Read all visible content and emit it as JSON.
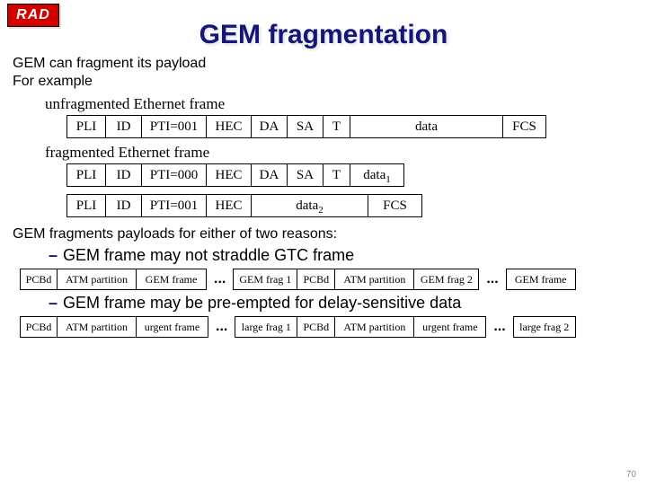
{
  "logo": "RAD",
  "title": "GEM fragmentation",
  "intro": {
    "line1": "GEM can fragment its payload",
    "line2": "For example"
  },
  "subhead_unfrag": "unfragmented Ethernet frame",
  "subhead_frag": "fragmented Ethernet frame",
  "frame_unfrag": {
    "pli": "PLI",
    "id": "ID",
    "pti": "PTI=001",
    "hec": "HEC",
    "da": "DA",
    "sa": "SA",
    "t": "T",
    "data": "data",
    "fcs": "FCS"
  },
  "frame_frag1": {
    "pli": "PLI",
    "id": "ID",
    "pti": "PTI=000",
    "hec": "HEC",
    "da": "DA",
    "sa": "SA",
    "t": "T",
    "data_base": "data",
    "data_sub": "1"
  },
  "frame_frag2": {
    "pli": "PLI",
    "id": "ID",
    "pti": "PTI=001",
    "hec": "HEC",
    "data_base": "data",
    "data_sub": "2",
    "fcs": "FCS"
  },
  "reasons_intro": "GEM fragments payloads for either of two reasons:",
  "bullet1": "GEM frame may not straddle GTC frame",
  "bullet2": "GEM frame may be pre-empted for delay-sensitive data",
  "gtc_row1": {
    "pcbd": "PCBd",
    "atm": "ATM partition",
    "gem": "GEM frame",
    "dots": "...",
    "frag1": "GEM frag 1",
    "pcbd2": "PCBd",
    "atm2": "ATM partition",
    "frag2": "GEM frag 2",
    "dots2": "...",
    "gem2": "GEM frame"
  },
  "gtc_row2": {
    "pcbd": "PCBd",
    "atm": "ATM partition",
    "urg": "urgent frame",
    "dots": "...",
    "lf1": "large frag 1",
    "pcbd2": "PCBd",
    "atm2": "ATM partition",
    "urg2": "urgent frame",
    "dots2": "...",
    "lf2": "large frag 2"
  },
  "pagenum": "70"
}
